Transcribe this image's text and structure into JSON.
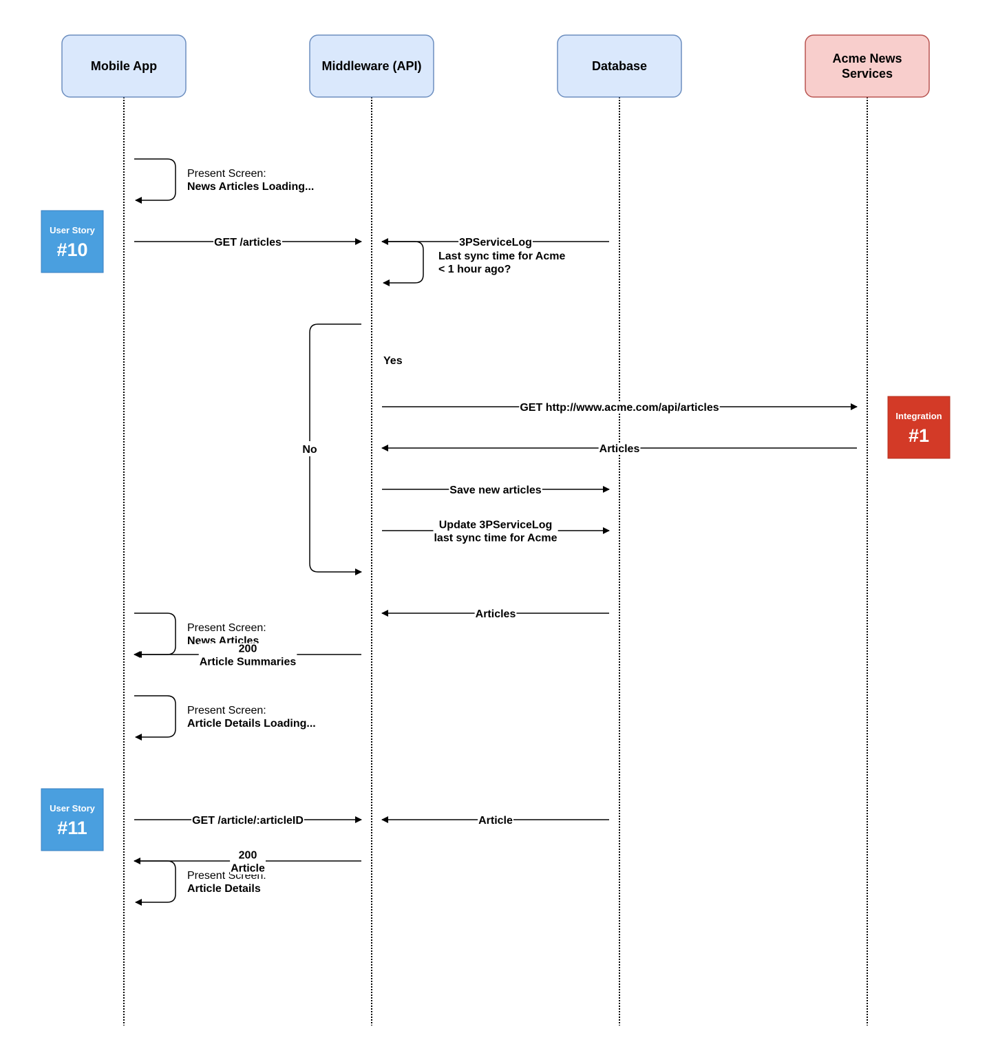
{
  "colors": {
    "actor_blue_fill": "#dae8fc",
    "actor_blue_stroke": "#6c8ebf",
    "actor_red_fill": "#f8cecc",
    "actor_red_stroke": "#b85450",
    "user_story_fill": "#4a9fdf",
    "integration_fill": "#d33a27",
    "line": "#000000"
  },
  "actors": [
    {
      "id": "mobile",
      "label": "Mobile App",
      "style": "blue"
    },
    {
      "id": "api",
      "label": "Middleware (API)",
      "style": "blue"
    },
    {
      "id": "db",
      "label": "Database",
      "style": "blue"
    },
    {
      "id": "acme",
      "label": "Acme News\nServices",
      "style": "red"
    }
  ],
  "self_notes": [
    {
      "actor": "mobile",
      "row": 0,
      "line1": "Present Screen:",
      "line2": "News Articles Loading...",
      "line2_bold": true
    },
    {
      "actor": "api",
      "row": 2,
      "line1": "Last sync time for Acme",
      "line2": "< 1 hour ago?",
      "line1_bold": true,
      "line2_bold": true
    },
    {
      "actor": "mobile",
      "row": 11,
      "line1": "Present Screen:",
      "line2": "News Articles",
      "line2_bold": true
    },
    {
      "actor": "mobile",
      "row": 13,
      "line1": "Present Screen:",
      "line2": "Article Details Loading...",
      "line2_bold": true
    },
    {
      "actor": "mobile",
      "row": 17,
      "line1": "Present Screen:",
      "line2": "Article Details",
      "line2_bold": true
    }
  ],
  "messages": [
    {
      "from": "mobile",
      "to": "api",
      "row": 1,
      "label": "GET /articles"
    },
    {
      "from": "db",
      "to": "api",
      "row": 1,
      "label": "3PServiceLog"
    },
    {
      "from": "api",
      "to": "acme",
      "row": 5,
      "label": "GET http://www.acme.com/api/articles"
    },
    {
      "from": "acme",
      "to": "api",
      "row": 6,
      "label": "Articles"
    },
    {
      "from": "api",
      "to": "db",
      "row": 7,
      "label": "Save new articles"
    },
    {
      "from": "api",
      "to": "db",
      "row": 8,
      "label": "Update 3PServiceLog\nlast sync time for Acme"
    },
    {
      "from": "db",
      "to": "api",
      "row": 10,
      "label": "Articles"
    },
    {
      "from": "api",
      "to": "mobile",
      "row": 11,
      "label": "200\nArticle Summaries"
    },
    {
      "from": "mobile",
      "to": "api",
      "row": 15,
      "label": "GET /article/:articleID"
    },
    {
      "from": "db",
      "to": "api",
      "row": 15,
      "label": "Article"
    },
    {
      "from": "api",
      "to": "mobile",
      "row": 16,
      "label": "200\nArticle"
    }
  ],
  "branch": {
    "yes_label": "Yes",
    "no_label": "No"
  },
  "badges": [
    {
      "type": "user-story",
      "title": "User Story",
      "number": "#10",
      "row": 1,
      "side": "left"
    },
    {
      "type": "integration",
      "title": "Integration",
      "number": "#1",
      "row": 5.5,
      "side": "right"
    },
    {
      "type": "user-story",
      "title": "User Story",
      "number": "#11",
      "row": 15,
      "side": "left"
    }
  ]
}
